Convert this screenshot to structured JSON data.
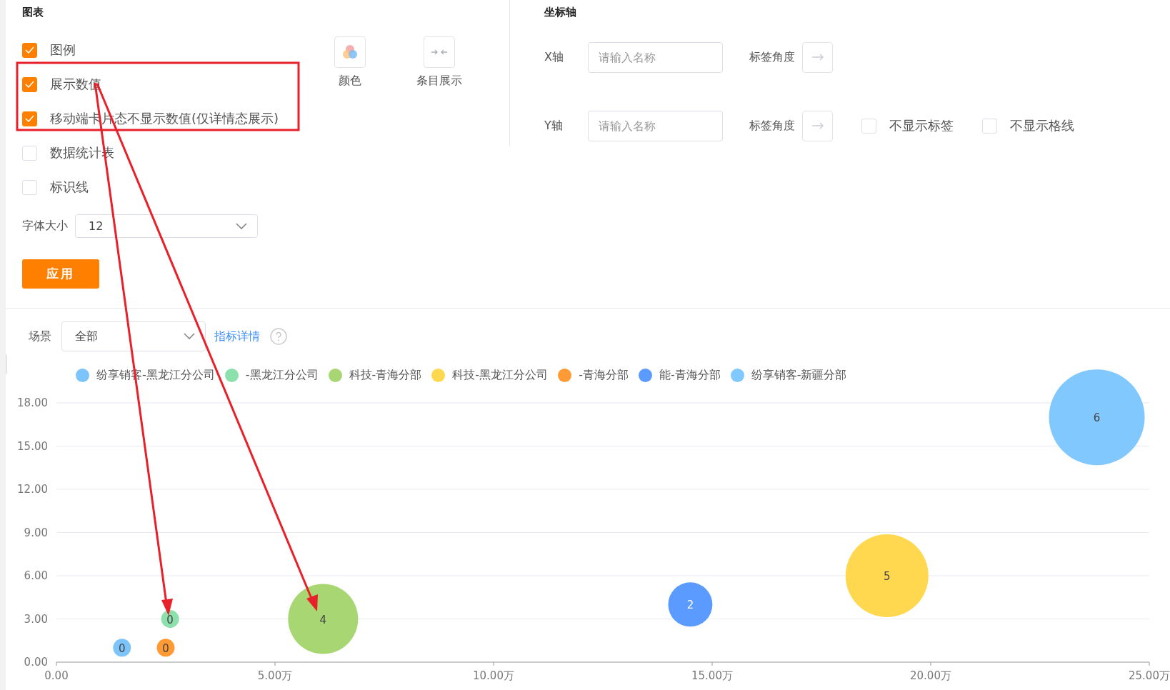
{
  "chart_settings": {
    "title": "图表",
    "options": [
      {
        "label": "图例",
        "checked": true
      },
      {
        "label": "展示数值",
        "checked": true
      },
      {
        "label": "移动端卡片态不显示数值(仅详情态展示)",
        "checked": true
      },
      {
        "label": "数据统计表",
        "checked": false
      },
      {
        "label": "标识线",
        "checked": false
      }
    ],
    "tools": [
      {
        "kind": "color",
        "label": "颜色"
      },
      {
        "kind": "compact",
        "label": "条目展示"
      }
    ],
    "font_size": {
      "label": "字体大小",
      "value": "12"
    },
    "apply_button": "应用"
  },
  "axis_settings": {
    "title": "坐标轴",
    "axes": [
      {
        "label": "X轴",
        "placeholder": "请输入名称",
        "angle_label": "标签角度"
      },
      {
        "label": "Y轴",
        "placeholder": "请输入名称",
        "angle_label": "标签角度",
        "toggles": [
          {
            "label": "不显示标签",
            "checked": false
          },
          {
            "label": "不显示格线",
            "checked": false
          }
        ]
      }
    ]
  },
  "filter": {
    "label": "场景",
    "value": "全部",
    "link": "指标详情"
  },
  "chart_data": {
    "type": "scatter",
    "grid": true,
    "xlim": [
      0,
      25
    ],
    "ylim": [
      0,
      18
    ],
    "xticks": [
      {
        "value": 0,
        "label": "0.00"
      },
      {
        "value": 5,
        "label": "5.00万"
      },
      {
        "value": 10,
        "label": "10.00万"
      },
      {
        "value": 15,
        "label": "15.00万"
      },
      {
        "value": 20,
        "label": "20.00万"
      },
      {
        "value": 25,
        "label": "25.00万"
      }
    ],
    "yticks": [
      {
        "value": 0,
        "label": "0.00"
      },
      {
        "value": 3,
        "label": "3.00"
      },
      {
        "value": 6,
        "label": "6.00"
      },
      {
        "value": 9,
        "label": "9.00"
      },
      {
        "value": 12,
        "label": "12.00"
      },
      {
        "value": 15,
        "label": "15.00"
      },
      {
        "value": 18,
        "label": "18.00"
      }
    ],
    "series": [
      {
        "name": "纷享销客-黑龙江分公司",
        "color": "#7cc4fa",
        "x": [
          1.5
        ],
        "values": [
          1
        ]
      },
      {
        "name": "-黑龙江分公司",
        "color": "#8be0ac",
        "x": [
          2.6
        ],
        "values": [
          3
        ]
      },
      {
        "name": "科技-青海分部",
        "color": "#a8d672",
        "x": [
          6.1
        ],
        "values": [
          3
        ]
      },
      {
        "name": "科技-黑龙江分公司",
        "color": "#ffd84f",
        "x": [
          19
        ],
        "values": [
          6
        ]
      },
      {
        "name": "-青海分部",
        "color": "#ff9a35",
        "x": [
          2.5
        ],
        "values": [
          1
        ]
      },
      {
        "name": "能-青海分部",
        "color": "#5b9bff",
        "x": [
          14.5
        ],
        "values": [
          4
        ]
      },
      {
        "name": "纷享销客-新疆分部",
        "color": "#80c8fd",
        "x": [
          23.8
        ],
        "values": [
          17
        ]
      }
    ],
    "annotations": [
      {
        "x": 1.5,
        "y": 1,
        "text": "0"
      },
      {
        "x": 2.6,
        "y": 3,
        "text": "0"
      },
      {
        "x": 6.1,
        "y": 3,
        "text": "4"
      },
      {
        "x": 19,
        "y": 6,
        "text": "5"
      },
      {
        "x": 2.5,
        "y": 1,
        "text": "0"
      },
      {
        "x": 14.5,
        "y": 4,
        "text": "2"
      },
      {
        "x": 23.8,
        "y": 17,
        "text": "6"
      }
    ]
  }
}
